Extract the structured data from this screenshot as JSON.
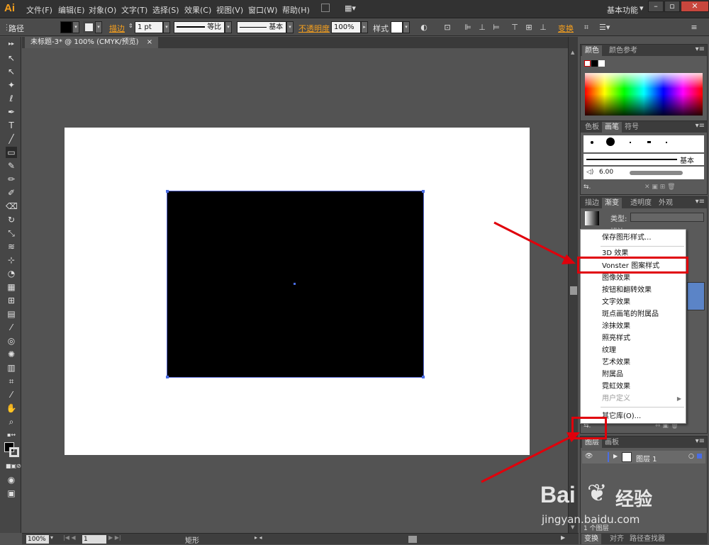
{
  "app": {
    "logo": "Ai",
    "workspace": "基本功能",
    "workspace_arrow": "▾",
    "window_controls": [
      "–",
      "▫",
      "✕"
    ]
  },
  "menu": [
    "文件(F)",
    "编辑(E)",
    "对象(O)",
    "文字(T)",
    "选择(S)",
    "效果(C)",
    "视图(V)",
    "窗口(W)",
    "帮助(H)"
  ],
  "control_bar": {
    "object_type": "路径",
    "stroke_label": "描边",
    "stroke_weight": "1 pt",
    "stroke_profile": "等比",
    "brush_def": "基本",
    "opacity_label": "不透明度",
    "opacity_value": "100%",
    "style_label": "样式",
    "transform_label": "变换"
  },
  "document": {
    "tab_title": "未标题-3* @ 100% (CMYK/预览)",
    "tab_close": "×"
  },
  "status_bar": {
    "zoom": "100%",
    "page": "1",
    "tool_name": "矩形"
  },
  "panels": {
    "color": {
      "tabs": [
        "颜色",
        "颜色参考"
      ]
    },
    "brushes": {
      "tabs": [
        "色板",
        "画笔",
        "符号"
      ],
      "basic_label": "基本",
      "size_value": "6.00"
    },
    "appearance": {
      "tabs": [
        "描边",
        "渐变",
        "透明度",
        "外观"
      ],
      "type_label": "类型:",
      "stroke_label": "描边"
    },
    "layers": {
      "tabs": [
        "图层",
        "画板"
      ],
      "layer_name": "图层 1",
      "layer_count": "1 个图层"
    },
    "bottom_tabs": [
      "变换",
      "对齐",
      "路径查找器"
    ],
    "library_button": "⇆."
  },
  "graphic_styles_menu": {
    "items": [
      {
        "label": "保存图形样式...",
        "disabled": false
      },
      {
        "label": "3D 效果",
        "disabled": false
      },
      {
        "label": "Vonster 图案样式",
        "disabled": false
      },
      {
        "label": "图像效果",
        "disabled": false
      },
      {
        "label": "按钮和翻转效果",
        "disabled": false
      },
      {
        "label": "文字效果",
        "disabled": false
      },
      {
        "label": "斑点画笔的附属品",
        "disabled": false
      },
      {
        "label": "涂抹效果",
        "disabled": false
      },
      {
        "label": "照亮样式",
        "disabled": false
      },
      {
        "label": "纹理",
        "disabled": false
      },
      {
        "label": "艺术效果",
        "disabled": false
      },
      {
        "label": "附属品",
        "disabled": false
      },
      {
        "label": "霓虹效果",
        "disabled": false
      },
      {
        "label": "用户定义",
        "disabled": true
      },
      {
        "label": "其它库(O)...",
        "disabled": false
      }
    ]
  },
  "watermark": {
    "brand": "Bai",
    "brand_cn": "经验",
    "url": "jingyan.baidu.com"
  },
  "colors": {
    "accent": "#f7a01d",
    "annotation": "#e0000b",
    "selection": "#4a6de5"
  }
}
